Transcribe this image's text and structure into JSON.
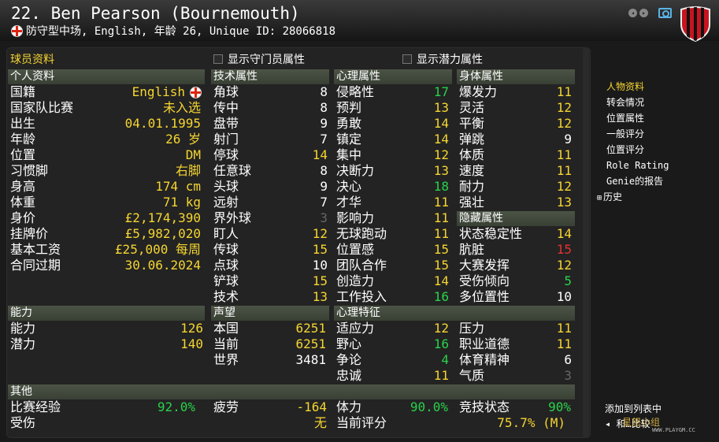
{
  "header": {
    "title": "22. Ben Pearson (Bournemouth)",
    "subtitle": "防守型中场, English, 年龄 26, Unique ID: 28066818",
    "nav_prev": "◂",
    "nav_next": "▸",
    "icons": [
      "flag-england-icon",
      "camera-icon",
      "club-badge-icon"
    ],
    "badge_colors": {
      "red": "#c8141e",
      "black": "#111111"
    }
  },
  "panel": {
    "title": "球员资料",
    "checkbox_gk": "显示守门员属性",
    "checkbox_potential": "显示潜力属性"
  },
  "personal": {
    "header": "个人资料",
    "rows": [
      {
        "label": "国籍",
        "value": "English"
      },
      {
        "label": "国家队比赛",
        "value": "未入选"
      },
      {
        "label": "出生",
        "value": "04.01.1995"
      },
      {
        "label": "年龄",
        "value": "26 岁"
      },
      {
        "label": "位置",
        "value": "DM"
      },
      {
        "label": "习惯脚",
        "value": "右脚"
      },
      {
        "label": "身高",
        "value": "174 cm"
      },
      {
        "label": "体重",
        "value": "71 kg"
      },
      {
        "label": "身价",
        "value": "£2,174,390"
      },
      {
        "label": "挂牌价",
        "value": "£5,982,020"
      },
      {
        "label": "基本工资",
        "value": "£25,000 每周"
      },
      {
        "label": "合同过期",
        "value": "30.06.2024"
      }
    ]
  },
  "technical": {
    "header": "技术属性",
    "rows": [
      {
        "label": "角球",
        "value": "8",
        "color": "w"
      },
      {
        "label": "传中",
        "value": "8",
        "color": "w"
      },
      {
        "label": "盘带",
        "value": "9",
        "color": "w"
      },
      {
        "label": "射门",
        "value": "7",
        "color": "w"
      },
      {
        "label": "停球",
        "value": "14",
        "color": "y"
      },
      {
        "label": "任意球",
        "value": "8",
        "color": "w"
      },
      {
        "label": "头球",
        "value": "9",
        "color": "w"
      },
      {
        "label": "远射",
        "value": "7",
        "color": "w"
      },
      {
        "label": "界外球",
        "value": "3",
        "color": "d"
      },
      {
        "label": "盯人",
        "value": "12",
        "color": "y"
      },
      {
        "label": "传球",
        "value": "15",
        "color": "y"
      },
      {
        "label": "点球",
        "value": "10",
        "color": "w"
      },
      {
        "label": "铲球",
        "value": "15",
        "color": "y"
      },
      {
        "label": "技术",
        "value": "13",
        "color": "y"
      }
    ]
  },
  "mental": {
    "header": "心理属性",
    "rows": [
      {
        "label": "侵略性",
        "value": "17",
        "color": "g"
      },
      {
        "label": "预判",
        "value": "13",
        "color": "y"
      },
      {
        "label": "勇敢",
        "value": "14",
        "color": "y"
      },
      {
        "label": "镇定",
        "value": "14",
        "color": "y"
      },
      {
        "label": "集中",
        "value": "12",
        "color": "y"
      },
      {
        "label": "决断力",
        "value": "13",
        "color": "y"
      },
      {
        "label": "决心",
        "value": "18",
        "color": "g"
      },
      {
        "label": "才华",
        "value": "11",
        "color": "y"
      },
      {
        "label": "影响力",
        "value": "11",
        "color": "y"
      },
      {
        "label": "无球跑动",
        "value": "11",
        "color": "y"
      },
      {
        "label": "位置感",
        "value": "15",
        "color": "y"
      },
      {
        "label": "团队合作",
        "value": "15",
        "color": "y"
      },
      {
        "label": "创造力",
        "value": "14",
        "color": "y"
      },
      {
        "label": "工作投入",
        "value": "16",
        "color": "g"
      }
    ]
  },
  "physical": {
    "header": "身体属性",
    "rows": [
      {
        "label": "爆发力",
        "value": "11",
        "color": "y"
      },
      {
        "label": "灵活",
        "value": "12",
        "color": "y"
      },
      {
        "label": "平衡",
        "value": "12",
        "color": "y"
      },
      {
        "label": "弹跳",
        "value": "9",
        "color": "w"
      },
      {
        "label": "体质",
        "value": "11",
        "color": "y"
      },
      {
        "label": "速度",
        "value": "11",
        "color": "y"
      },
      {
        "label": "耐力",
        "value": "12",
        "color": "y"
      },
      {
        "label": "强壮",
        "value": "13",
        "color": "y"
      }
    ]
  },
  "hidden": {
    "header": "隐藏属性",
    "rows": [
      {
        "label": "状态稳定性",
        "value": "14",
        "color": "y"
      },
      {
        "label": "肮脏",
        "value": "15",
        "color": "r"
      },
      {
        "label": "大赛发挥",
        "value": "12",
        "color": "y"
      },
      {
        "label": "受伤倾向",
        "value": "5",
        "color": "g"
      },
      {
        "label": "多位置性",
        "value": "10",
        "color": "w"
      }
    ]
  },
  "ability": {
    "header": "能力",
    "rows": [
      {
        "label": "能力",
        "value": "126"
      },
      {
        "label": "潜力",
        "value": "140"
      }
    ]
  },
  "reputation": {
    "header": "声望",
    "rows": [
      {
        "label": "本国",
        "value": "6251",
        "color": "y"
      },
      {
        "label": "当前",
        "value": "6251",
        "color": "y"
      },
      {
        "label": "世界",
        "value": "3481",
        "color": "w"
      }
    ]
  },
  "traits": {
    "header": "心理特征",
    "col1": [
      {
        "label": "适应力",
        "value": "12",
        "color": "y"
      },
      {
        "label": "野心",
        "value": "16",
        "color": "g"
      },
      {
        "label": "争论",
        "value": "4",
        "color": "g"
      },
      {
        "label": "忠诚",
        "value": "11",
        "color": "y"
      }
    ],
    "col2": [
      {
        "label": "压力",
        "value": "11",
        "color": "y"
      },
      {
        "label": "职业道德",
        "value": "11",
        "color": "y"
      },
      {
        "label": "体育精神",
        "value": "6",
        "color": "w"
      },
      {
        "label": "气质",
        "value": "3",
        "color": "d"
      }
    ]
  },
  "other": {
    "header": "其他",
    "match_exp_label": "比赛经验",
    "match_exp_value": "92.0%",
    "injury_label": "受伤",
    "fatigue_label": "疲劳",
    "fatigue_value": "-164",
    "injury_value": "无",
    "fitness_label": "体力",
    "fitness_value": "90.0%",
    "current_rating_label": "当前评分",
    "form_label": "竞技状态",
    "form_value": "90%",
    "rating_value": "75.7% (M)"
  },
  "side_menu": {
    "items": [
      "人物资料",
      "转会情况",
      "位置属性",
      "一般评分",
      "位置评分",
      "Role Rating",
      "Genie的报告",
      "历史"
    ],
    "bottom_1": "添加到列表中",
    "bottom_2": "和…比较"
  },
  "watermark": {
    "text": "星怒小组",
    "url": "WWW.PLAYGM.CC"
  }
}
